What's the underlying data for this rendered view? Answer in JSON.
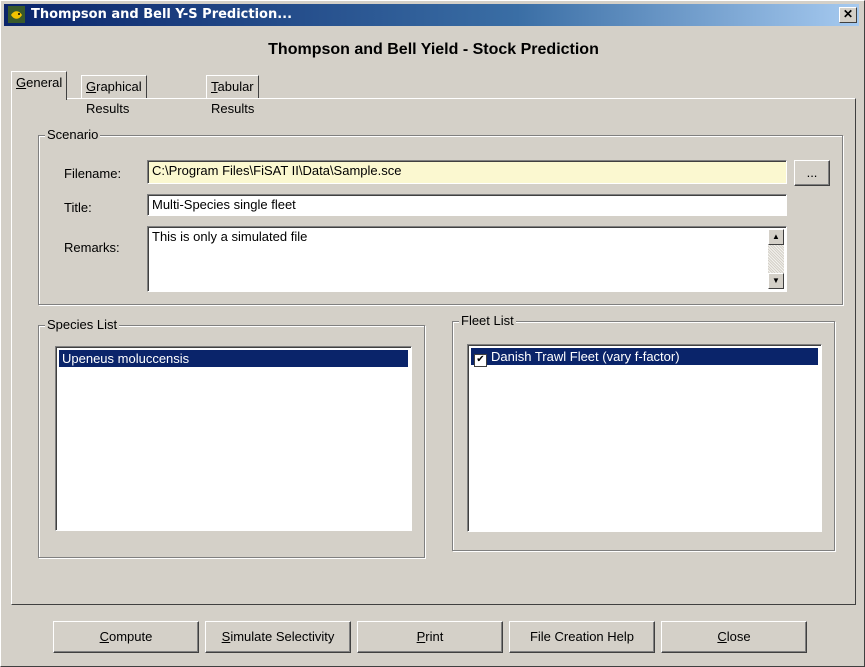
{
  "window": {
    "title": "Thompson and Bell Y-S Prediction...",
    "close_glyph": "✕"
  },
  "heading": "Thompson and Bell Yield - Stock Prediction",
  "tabs": [
    {
      "label": "General",
      "key": "G",
      "active": true
    },
    {
      "label": "Graphical Results",
      "key": "G",
      "active": false
    },
    {
      "label": "Tabular Results",
      "key": "T",
      "active": false
    }
  ],
  "scenario": {
    "group_label": "Scenario",
    "filename_label": "Filename:",
    "filename_value": "C:\\Program Files\\FiSAT II\\Data\\Sample.sce",
    "browse_label": "...",
    "title_label": "Title:",
    "title_value": "Multi-Species single fleet",
    "remarks_label": "Remarks:",
    "remarks_value": "This is only a simulated file"
  },
  "species_list": {
    "group_label": "Species List",
    "items": [
      "Upeneus moluccensis"
    ]
  },
  "fleet_list": {
    "group_label": "Fleet List",
    "items": [
      {
        "label": "Danish Trawl Fleet (vary f-factor)",
        "checked": true
      }
    ]
  },
  "buttons": {
    "compute": "Compute",
    "simulate": "Simulate Selectivity",
    "print": "Print",
    "help": "File Creation Help",
    "close": "Close"
  },
  "colors": {
    "titlebar": "#0a246a",
    "selection": "#0a246a",
    "filename_bg": "#fbf8d0"
  },
  "icons": {
    "app": "fish-app-icon",
    "close": "close-icon",
    "check": "checkmark-icon"
  }
}
